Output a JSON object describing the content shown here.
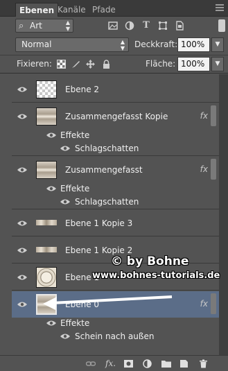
{
  "tabs": [
    {
      "label": "Ebenen",
      "active": true
    },
    {
      "label": "Kanäle",
      "active": false
    },
    {
      "label": "Pfade",
      "active": false
    }
  ],
  "filter": {
    "kind_label": "Art",
    "icons": [
      "image-filter-icon",
      "adjustment-filter-icon",
      "type-filter-icon",
      "shape-filter-icon",
      "smart-object-filter-icon"
    ]
  },
  "blend": {
    "mode": "Normal",
    "opacity_label": "Deckkraft:",
    "opacity_value": "100%"
  },
  "lock": {
    "label": "Fixieren:",
    "fill_label": "Fläche:",
    "fill_value": "100%"
  },
  "layers": [
    {
      "name": "Ebene 2",
      "thumb": "checker",
      "fx": false
    },
    {
      "name": "Zusammengefasst Kopie",
      "thumb": "tex",
      "fx": true,
      "fx_label": "fx",
      "effects_label": "Effekte",
      "effect": "Schlagschatten"
    },
    {
      "name": "Zusammengefasst",
      "thumb": "tex",
      "fx": true,
      "fx_label": "fx",
      "effects_label": "Effekte",
      "effect": "Schlagschatten"
    },
    {
      "name": "Ebene 1 Kopie 3",
      "thumb": "strip",
      "fx": false
    },
    {
      "name": "Ebene 1 Kopie 2",
      "thumb": "strip",
      "fx": false
    },
    {
      "name": "Ebene 1",
      "thumb": "clock",
      "fx": false
    },
    {
      "name": "Ebene 0",
      "thumb": "tex",
      "fx": true,
      "fx_label": "fx",
      "selected": true,
      "effects_label": "Effekte",
      "effect": "Schein nach außen"
    }
  ],
  "watermark": {
    "line1": "© by Bohne",
    "line2": "www.bohnes-tutorials.de"
  },
  "bottom_icons": [
    "link-layers-icon",
    "fx-icon",
    "mask-icon",
    "adjustment-icon",
    "group-icon",
    "new-layer-icon",
    "trash-icon"
  ],
  "bottom_fx_label": "fx."
}
